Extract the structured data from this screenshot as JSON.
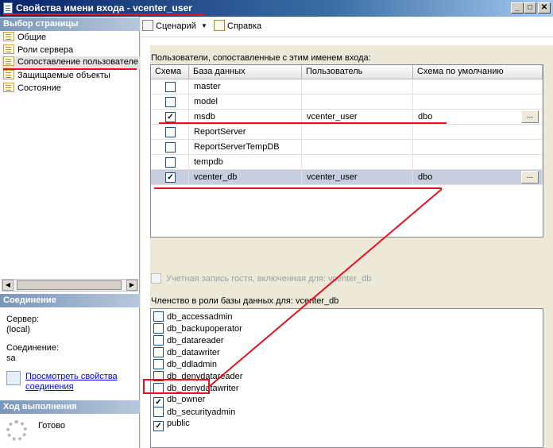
{
  "window": {
    "title": "Свойства имени входа - vcenter_user",
    "buttons": [
      "_",
      "□",
      "✕"
    ]
  },
  "left": {
    "select_page_header": "Выбор страницы",
    "pages": [
      "Общие",
      "Роли сервера",
      "Сопоставление пользователе",
      "Защищаемые объекты",
      "Состояние"
    ],
    "selected_page_index": 2,
    "connection_header": "Соединение",
    "server_label": "Сервер:",
    "server_value": "(local)",
    "connection_label": "Соединение:",
    "connection_value": "sa",
    "view_props_link": "Просмотреть свойства соединения",
    "progress_header": "Ход выполнения",
    "progress_status": "Готово"
  },
  "toolbar": {
    "script_label": "Сценарий",
    "help_label": "Справка",
    "icons": [
      "script-icon",
      "dropdown-arrow-icon",
      "help-icon"
    ]
  },
  "mapping": {
    "label": "Пользователи, сопоставленные с этим именем входа:",
    "columns": [
      "Схема",
      "База данных",
      "Пользователь",
      "Схема по умолчанию"
    ],
    "rows": [
      {
        "checked": false,
        "db": "master",
        "user": "",
        "schema": ""
      },
      {
        "checked": false,
        "db": "model",
        "user": "",
        "schema": ""
      },
      {
        "checked": true,
        "db": "msdb",
        "user": "vcenter_user",
        "schema": "dbo"
      },
      {
        "checked": false,
        "db": "ReportServer",
        "user": "",
        "schema": ""
      },
      {
        "checked": false,
        "db": "ReportServerTempDB",
        "user": "",
        "schema": ""
      },
      {
        "checked": false,
        "db": "tempdb",
        "user": "",
        "schema": ""
      },
      {
        "checked": true,
        "db": "vcenter_db",
        "user": "vcenter_user",
        "schema": "dbo"
      }
    ],
    "selected_row_index": 6,
    "ellipsis": "..."
  },
  "guest_label": "Учетная запись гостя, включенная для: vcenter_db",
  "roles": {
    "label": "Членство в роли базы данных для: vcenter_db",
    "items": [
      {
        "name": "db_accessadmin",
        "checked": false
      },
      {
        "name": "db_backupoperator",
        "checked": false
      },
      {
        "name": "db_datareader",
        "checked": false
      },
      {
        "name": "db_datawriter",
        "checked": false
      },
      {
        "name": "db_ddladmin",
        "checked": false
      },
      {
        "name": "db_denydatareader",
        "checked": false
      },
      {
        "name": "db_denydatawriter",
        "checked": false
      },
      {
        "name": "db_owner",
        "checked": true
      },
      {
        "name": "db_securityadmin",
        "checked": false
      },
      {
        "name": "public",
        "checked": true
      }
    ]
  },
  "colors": {
    "annotation_red": "#e8101e",
    "selected_row": "#c9cde0",
    "title_bar": "#0a246a"
  }
}
